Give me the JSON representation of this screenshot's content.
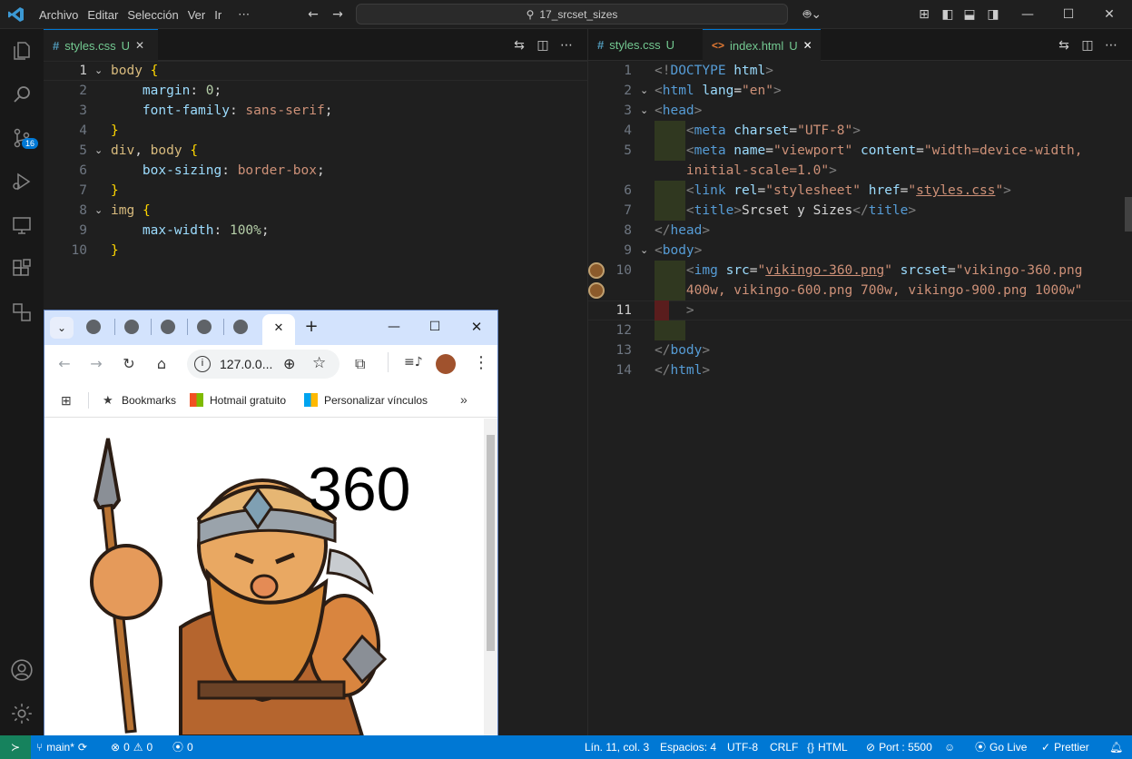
{
  "menu": [
    "Archivo",
    "Editar",
    "Selección",
    "Ver",
    "Ir",
    "⋯"
  ],
  "search_text": "17_srcset_sizes",
  "left_tab": {
    "icon": "#",
    "name": "styles.css",
    "status": "U",
    "close": "✕"
  },
  "right_tabs": [
    {
      "icon": "#",
      "name": "styles.css",
      "status": "U"
    },
    {
      "icon": "<>",
      "name": "index.html",
      "status": "U",
      "close": "✕"
    }
  ],
  "scm_badge": "16",
  "css_lines": [
    {
      "n": "1",
      "cur": true
    },
    {
      "n": "2"
    },
    {
      "n": "3"
    },
    {
      "n": "4"
    },
    {
      "n": "5"
    },
    {
      "n": "6"
    },
    {
      "n": "7"
    },
    {
      "n": "8"
    },
    {
      "n": "9"
    },
    {
      "n": "10"
    }
  ],
  "html_lines": [
    "1",
    "2",
    "3",
    "4",
    "5",
    "",
    "6",
    "7",
    "8",
    "9",
    "10",
    "",
    "11",
    "12",
    "13",
    "14"
  ],
  "browser": {
    "url": "127.0.0...",
    "bookmarks": [
      "Bookmarks",
      "Hotmail gratuito",
      "Personalizar vínculos"
    ],
    "overlay_text": "360"
  },
  "status": {
    "branch": "main*",
    "errors": "0",
    "warnings": "0",
    "ports": "0",
    "position": "Lín. 11, col. 3",
    "spaces": "Espacios: 4",
    "encoding": "UTF-8",
    "eol": "CRLF",
    "language": "HTML",
    "port": "Port : 5500",
    "golive": "Go Live",
    "prettier": "Prettier"
  }
}
